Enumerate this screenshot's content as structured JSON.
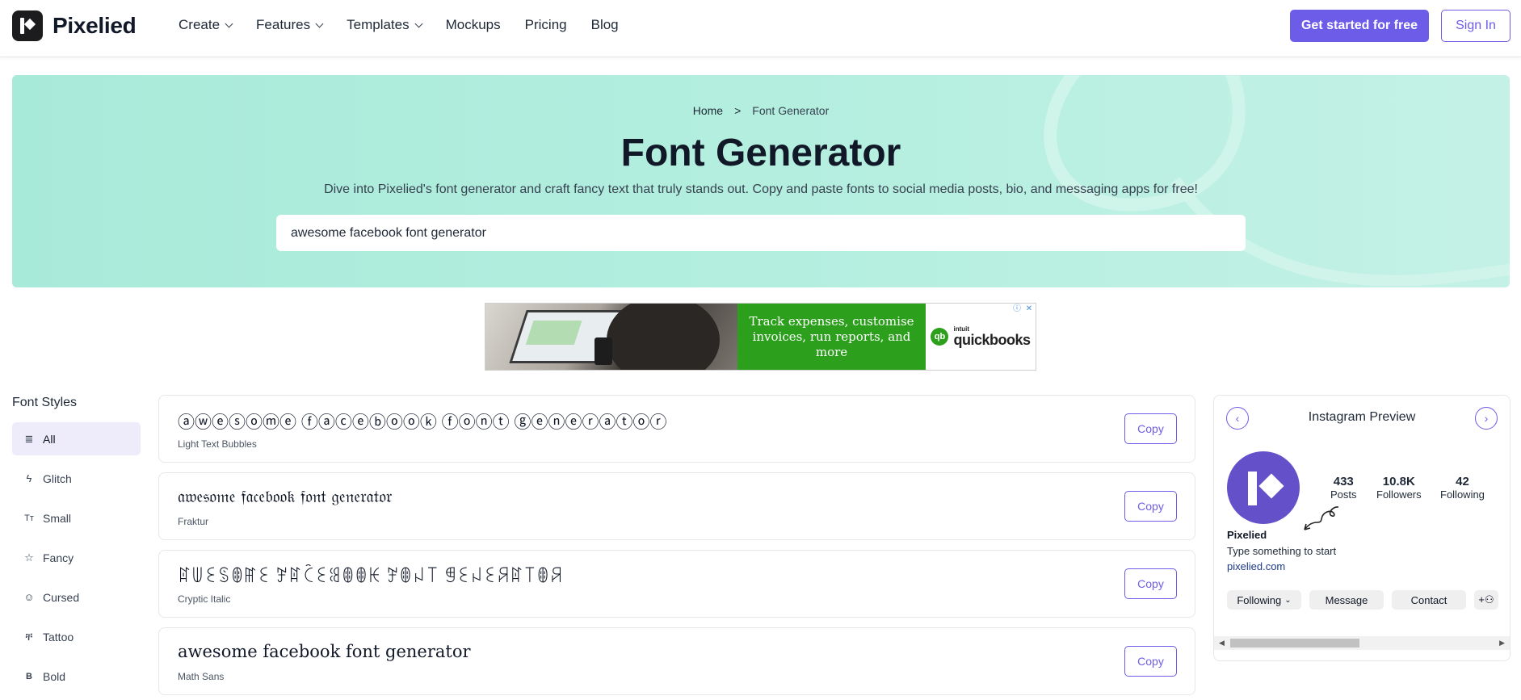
{
  "brand": {
    "name": "Pixelied"
  },
  "nav": {
    "items": [
      {
        "label": "Create",
        "dropdown": true
      },
      {
        "label": "Features",
        "dropdown": true
      },
      {
        "label": "Templates",
        "dropdown": true
      },
      {
        "label": "Mockups",
        "dropdown": false
      },
      {
        "label": "Pricing",
        "dropdown": false
      },
      {
        "label": "Blog",
        "dropdown": false
      }
    ],
    "cta_label": "Get started for free",
    "signin_label": "Sign In"
  },
  "hero": {
    "breadcrumb": {
      "home": "Home",
      "separator": ">",
      "current": "Font Generator"
    },
    "title": "Font Generator",
    "subtitle": "Dive into Pixelied's font generator and craft fancy text that truly stands out. Copy and paste fonts to social media posts, bio, and messaging apps for free!",
    "input_value": "awesome facebook font generator"
  },
  "ad": {
    "headline": "Track expenses, customise invoices, run reports, and more",
    "brand_small": "intuit",
    "brand_name": "quickbooks",
    "brand_mark": "qb"
  },
  "sidebar": {
    "title": "Font Styles",
    "items": [
      {
        "label": "All",
        "icon": "lines-icon",
        "glyph": "≣",
        "active": true
      },
      {
        "label": "Glitch",
        "icon": "bolt-icon",
        "glyph": "ϟ",
        "active": false
      },
      {
        "label": "Small",
        "icon": "text-size-icon",
        "glyph": "Tт",
        "active": false
      },
      {
        "label": "Fancy",
        "icon": "star-icon",
        "glyph": "☆",
        "active": false
      },
      {
        "label": "Cursed",
        "icon": "smiley-icon",
        "glyph": "☺",
        "active": false
      },
      {
        "label": "Tattoo",
        "icon": "tattoo-icon",
        "glyph": "ቸ",
        "active": false
      },
      {
        "label": "Bold",
        "icon": "bold-icon",
        "glyph": "B",
        "active": false
      }
    ]
  },
  "fonts": [
    {
      "sample": "ⓐⓦⓔⓢⓞⓜⓔ ⓕⓐⓒⓔⓑⓞⓞⓚ ⓕⓞⓝⓣ ⓖⓔⓝⓔⓡⓐⓣⓞⓡ",
      "label": "Light Text Bubbles",
      "copy": "Copy"
    },
    {
      "sample": "𝔞𝔴𝔢𝔰𝔬𝔪𝔢 𝔣𝔞𝔠𝔢𝔟𝔬𝔬𝔨 𝔣𝔬𝔫𝔱 𝔤𝔢𝔫𝔢𝔯𝔞𝔱𝔬𝔯",
      "label": "Fraktur",
      "copy": "Copy"
    },
    {
      "sample": "ꍏꅐꏂꌗꂦꂵꏂ ꎇꍏꉓꏂꌃꂦꂦꀘ ꎇꂦꈤ꓄ ꁅꏂꈤꏂꋪꍏ꓄ꂦꋪ",
      "label": "Cryptic Italic",
      "copy": "Copy"
    },
    {
      "sample": "awesome facebook font generator",
      "label": "Math Sans",
      "copy": "Copy"
    }
  ],
  "instagram": {
    "title": "Instagram Preview",
    "posts": {
      "value": "433",
      "label": "Posts"
    },
    "followers": {
      "value": "10.8K",
      "label": "Followers"
    },
    "following": {
      "value": "42",
      "label": "Following"
    },
    "name": "Pixelied",
    "bio": "Type something to start",
    "link": "pixelied.com",
    "buttons": {
      "following": "Following",
      "message": "Message",
      "contact": "Contact"
    }
  },
  "colors": {
    "accent": "#6d5ce8",
    "hero_bg": "#b2ecdc",
    "ad_green": "#2ca01c"
  }
}
